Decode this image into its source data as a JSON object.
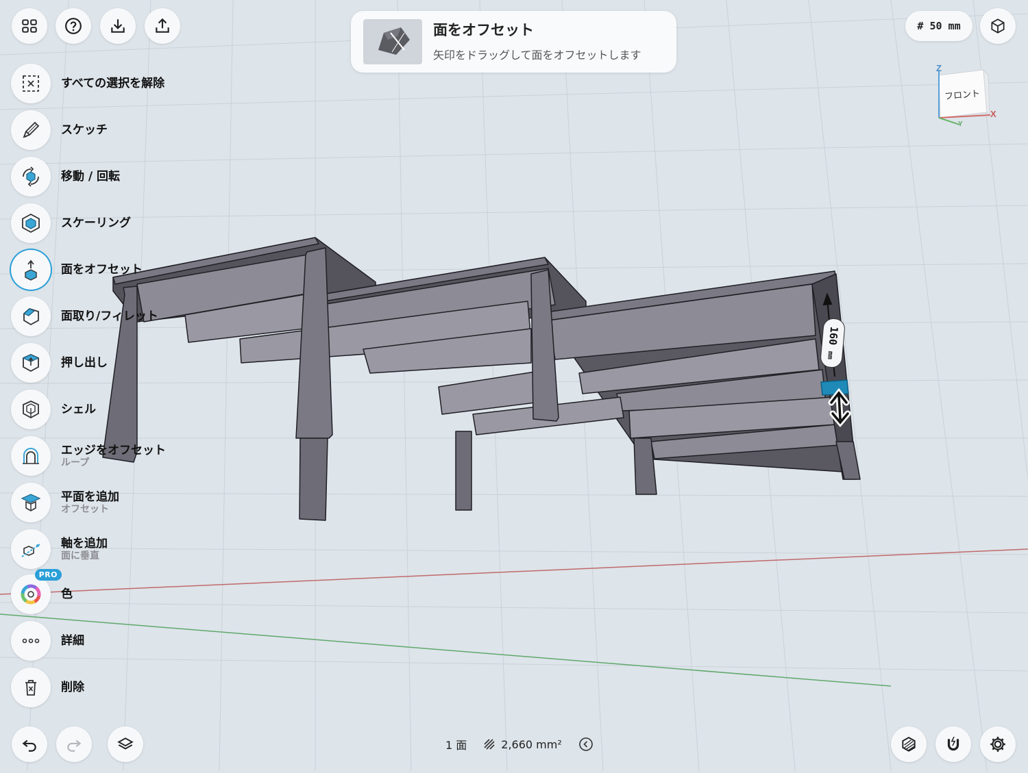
{
  "top_bar": {
    "hint_title": "面をオフセット",
    "hint_description": "矢印をドラッグして面をオフセットします",
    "grid_size": "# 50 mm"
  },
  "tools": [
    {
      "label": "すべての選択を解除",
      "sub": "",
      "icon": "deselect-icon"
    },
    {
      "label": "スケッチ",
      "sub": "",
      "icon": "pencil-icon"
    },
    {
      "label": "移動 / 回転",
      "sub": "",
      "icon": "move-rotate-icon"
    },
    {
      "label": "スケーリング",
      "sub": "",
      "icon": "scale-icon"
    },
    {
      "label": "面をオフセット",
      "sub": "",
      "icon": "offset-face-icon",
      "active": true
    },
    {
      "label": "面取り/フィレット",
      "sub": "",
      "icon": "chamfer-fillet-icon"
    },
    {
      "label": "押し出し",
      "sub": "",
      "icon": "extrude-icon"
    },
    {
      "label": "シェル",
      "sub": "",
      "icon": "shell-icon"
    },
    {
      "label": "エッジをオフセット",
      "sub": "ループ",
      "icon": "offset-edge-icon"
    },
    {
      "label": "平面を追加",
      "sub": "オフセット",
      "icon": "add-plane-icon"
    },
    {
      "label": "軸を追加",
      "sub": "面に垂直",
      "icon": "add-axis-icon"
    },
    {
      "label": "色",
      "sub": "",
      "icon": "color-wheel-icon",
      "badge": "PRO"
    },
    {
      "label": "詳細",
      "sub": "",
      "icon": "more-icon"
    },
    {
      "label": "削除",
      "sub": "",
      "icon": "trash-icon"
    }
  ],
  "view_cube": {
    "face_label": "フロント",
    "axis_z": "Z",
    "axis_x": "X",
    "axis_y": "Y"
  },
  "dimension": {
    "value": "160",
    "unit": "mm"
  },
  "status_bar": {
    "face_count": "1 面",
    "area": "2,660 mm²"
  },
  "colors": {
    "accent": "#2a9fd8",
    "model": "#5f5e68",
    "selected_face": "#1f8ab8",
    "x_axis": "#c06a6a",
    "y_axis": "#5fa86a"
  }
}
